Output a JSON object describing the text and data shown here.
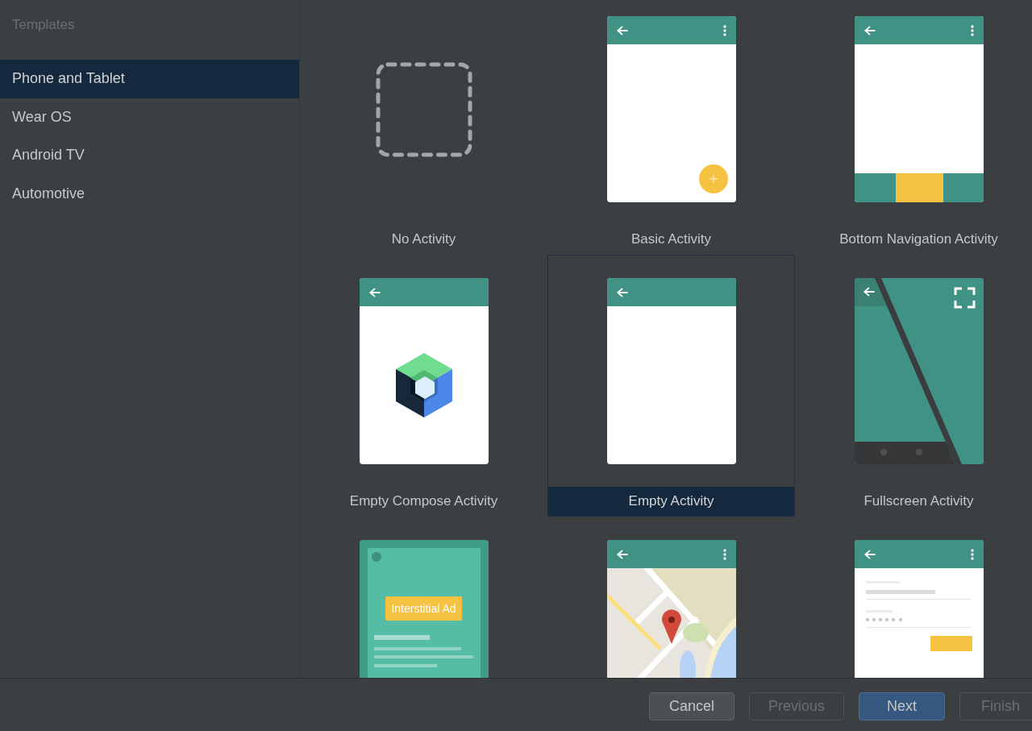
{
  "sidebar": {
    "title": "Templates",
    "items": [
      {
        "label": "Phone and Tablet",
        "selected": true
      },
      {
        "label": "Wear OS",
        "selected": false
      },
      {
        "label": "Android TV",
        "selected": false
      },
      {
        "label": "Automotive",
        "selected": false
      }
    ]
  },
  "templates": [
    {
      "name": "No Activity",
      "kind": "none",
      "selected": false
    },
    {
      "name": "Basic Activity",
      "kind": "basic",
      "selected": false
    },
    {
      "name": "Bottom Navigation Activity",
      "kind": "bottom_nav",
      "selected": false
    },
    {
      "name": "Empty Compose Activity",
      "kind": "compose",
      "selected": false
    },
    {
      "name": "Empty Activity",
      "kind": "empty",
      "selected": true
    },
    {
      "name": "Fullscreen Activity",
      "kind": "fullscreen",
      "selected": false
    },
    {
      "kind": "interstitial",
      "ad_label": "Interstitial Ad",
      "selected": false
    },
    {
      "kind": "maps",
      "selected": false
    },
    {
      "kind": "login",
      "selected": false
    }
  ],
  "buttons": [
    {
      "label": "Cancel",
      "kind": "default",
      "disabled": false
    },
    {
      "label": "Previous",
      "kind": "default",
      "disabled": true
    },
    {
      "label": "Next",
      "kind": "primary",
      "disabled": false
    },
    {
      "label": "Finish",
      "kind": "default",
      "disabled": true
    }
  ]
}
